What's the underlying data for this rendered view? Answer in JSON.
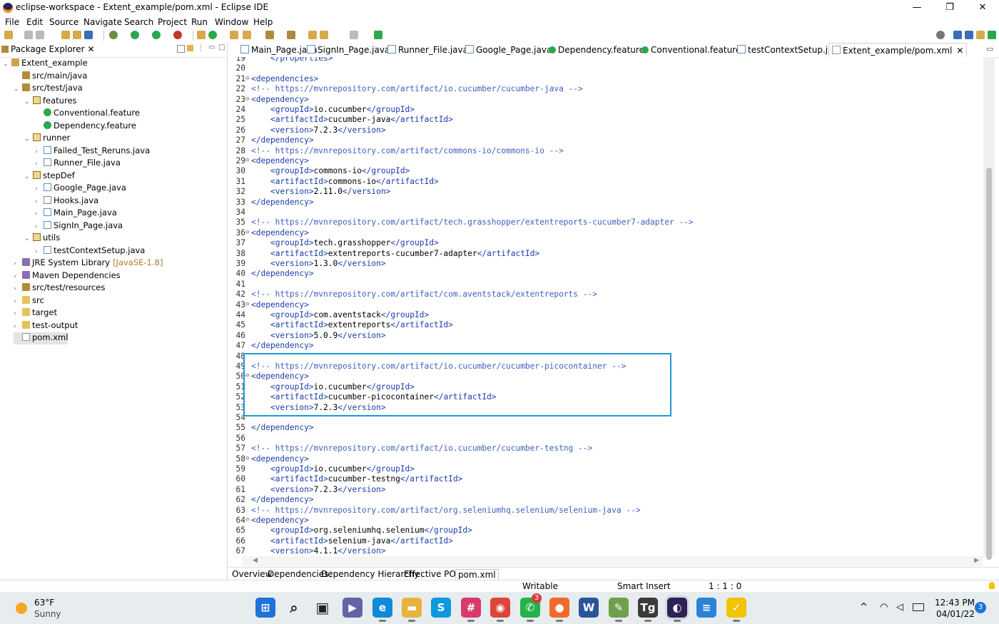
{
  "window": {
    "title": "eclipse-workspace - Extent_example/pom.xml - Eclipse IDE",
    "minimize": "—",
    "restore": "❐",
    "close": "✕"
  },
  "menu": [
    "File",
    "Edit",
    "Source",
    "Navigate",
    "Search",
    "Project",
    "Run",
    "Window",
    "Help"
  ],
  "package_explorer": {
    "title": "Package Explorer",
    "close": "✕",
    "tree": [
      {
        "label": "Extent_example",
        "twisty": "⌄",
        "icon": "project-icon"
      },
      {
        "label": "src/main/java",
        "twisty": "",
        "icon": "source-folder-icon"
      },
      {
        "label": "src/test/java",
        "twisty": "⌄",
        "icon": "source-folder-icon"
      },
      {
        "label": "features",
        "twisty": "⌄",
        "icon": "package-icon"
      },
      {
        "label": "Conventional.feature",
        "twisty": "",
        "icon": "feature-file-icon"
      },
      {
        "label": "Dependency.feature",
        "twisty": "",
        "icon": "feature-file-icon"
      },
      {
        "label": "runner",
        "twisty": "⌄",
        "icon": "package-icon"
      },
      {
        "label": "Failed_Test_Reruns.java",
        "twisty": "›",
        "icon": "java-file-icon"
      },
      {
        "label": "Runner_File.java",
        "twisty": "›",
        "icon": "java-file-icon"
      },
      {
        "label": "stepDef",
        "twisty": "⌄",
        "icon": "package-icon"
      },
      {
        "label": "Google_Page.java",
        "twisty": "›",
        "icon": "java-file-icon"
      },
      {
        "label": "Hooks.java",
        "twisty": "›",
        "icon": "java-file-icon"
      },
      {
        "label": "Main_Page.java",
        "twisty": "›",
        "icon": "java-file-icon"
      },
      {
        "label": "SignIn_Page.java",
        "twisty": "›",
        "icon": "java-file-icon"
      },
      {
        "label": "utils",
        "twisty": "⌄",
        "icon": "package-icon"
      },
      {
        "label": "testContextSetup.java",
        "twisty": "›",
        "icon": "java-file-icon"
      },
      {
        "label": "JRE System Library",
        "suffix": "[JavaSE-1.8]",
        "twisty": "›",
        "icon": "library-icon"
      },
      {
        "label": "Maven Dependencies",
        "twisty": "›",
        "icon": "library-icon"
      },
      {
        "label": "src/test/resources",
        "twisty": "›",
        "icon": "source-folder-icon"
      },
      {
        "label": "src",
        "twisty": "›",
        "icon": "folder-icon"
      },
      {
        "label": "target",
        "twisty": "›",
        "icon": "folder-icon"
      },
      {
        "label": "test-output",
        "twisty": "›",
        "icon": "folder-icon"
      },
      {
        "label": "pom.xml",
        "twisty": "",
        "icon": "xml-file-icon"
      }
    ]
  },
  "editor_tabs": [
    {
      "label": "Main_Page.java",
      "icon": "java-file-icon"
    },
    {
      "label": "SignIn_Page.java",
      "icon": "java-file-icon"
    },
    {
      "label": "Runner_File.java",
      "icon": "java-file-icon"
    },
    {
      "label": "Google_Page.java",
      "icon": "java-file-icon"
    },
    {
      "label": "Dependency.feature",
      "icon": "feature-file-icon"
    },
    {
      "label": "Conventional.feature",
      "icon": "feature-file-icon"
    },
    {
      "label": "testContextSetup.java",
      "icon": "java-file-icon"
    },
    {
      "label": "Extent_example/pom.xml",
      "icon": "xml-file-icon",
      "active": true,
      "close": "✕"
    }
  ],
  "code_lines": [
    {
      "n": "19",
      "t": "    </properties>"
    },
    {
      "n": "20",
      "t": ""
    },
    {
      "n": "21",
      "t": "<dependencies>",
      "fold": true
    },
    {
      "n": "22",
      "t": "<!-- https://mvnrepository.com/artifact/io.cucumber/cucumber-java -->"
    },
    {
      "n": "23",
      "t": "<dependency>",
      "fold": true
    },
    {
      "n": "24",
      "t": "    <groupId>io.cucumber</groupId>"
    },
    {
      "n": "25",
      "t": "    <artifactId>cucumber-java</artifactId>"
    },
    {
      "n": "26",
      "t": "    <version>7.2.3</version>"
    },
    {
      "n": "27",
      "t": "</dependency>"
    },
    {
      "n": "28",
      "t": "<!-- https://mvnrepository.com/artifact/commons-io/commons-io -->"
    },
    {
      "n": "29",
      "t": "<dependency>",
      "fold": true
    },
    {
      "n": "30",
      "t": "    <groupId>commons-io</groupId>"
    },
    {
      "n": "31",
      "t": "    <artifactId>commons-io</artifactId>"
    },
    {
      "n": "32",
      "t": "    <version>2.11.0</version>"
    },
    {
      "n": "33",
      "t": "</dependency>"
    },
    {
      "n": "34",
      "t": ""
    },
    {
      "n": "35",
      "t": "<!-- https://mvnrepository.com/artifact/tech.grasshopper/extentreports-cucumber7-adapter -->"
    },
    {
      "n": "36",
      "t": "<dependency>",
      "fold": true
    },
    {
      "n": "37",
      "t": "    <groupId>tech.grasshopper</groupId>"
    },
    {
      "n": "38",
      "t": "    <artifactId>extentreports-cucumber7-adapter</artifactId>"
    },
    {
      "n": "39",
      "t": "    <version>1.3.0</version>"
    },
    {
      "n": "40",
      "t": "</dependency>"
    },
    {
      "n": "41",
      "t": ""
    },
    {
      "n": "42",
      "t": "<!-- https://mvnrepository.com/artifact/com.aventstack/extentreports -->"
    },
    {
      "n": "43",
      "t": "<dependency>",
      "fold": true
    },
    {
      "n": "44",
      "t": "    <groupId>com.aventstack</groupId>"
    },
    {
      "n": "45",
      "t": "    <artifactId>extentreports</artifactId>"
    },
    {
      "n": "46",
      "t": "    <version>5.0.9</version>"
    },
    {
      "n": "47",
      "t": "</dependency>"
    },
    {
      "n": "48",
      "t": ""
    },
    {
      "n": "49",
      "t": "<!-- https://mvnrepository.com/artifact/io.cucumber/cucumber-picocontainer -->"
    },
    {
      "n": "50",
      "t": "<dependency>",
      "fold": true
    },
    {
      "n": "51",
      "t": "    <groupId>io.cucumber</groupId>"
    },
    {
      "n": "52",
      "t": "    <artifactId>cucumber-picocontainer</artifactId>"
    },
    {
      "n": "53",
      "t": "    <version>7.2.3</version>"
    },
    {
      "n": "54",
      "t": ""
    },
    {
      "n": "55",
      "t": "</dependency>"
    },
    {
      "n": "56",
      "t": ""
    },
    {
      "n": "57",
      "t": "<!-- https://mvnrepository.com/artifact/io.cucumber/cucumber-testng -->"
    },
    {
      "n": "58",
      "t": "<dependency>",
      "fold": true
    },
    {
      "n": "59",
      "t": "    <groupId>io.cucumber</groupId>"
    },
    {
      "n": "60",
      "t": "    <artifactId>cucumber-testng</artifactId>"
    },
    {
      "n": "61",
      "t": "    <version>7.2.3</version>"
    },
    {
      "n": "62",
      "t": "</dependency>"
    },
    {
      "n": "63",
      "t": "<!-- https://mvnrepository.com/artifact/org.seleniumhq.selenium/selenium-java -->"
    },
    {
      "n": "64",
      "t": "<dependency>",
      "fold": true
    },
    {
      "n": "65",
      "t": "    <groupId>org.seleniumhq.selenium</groupId>"
    },
    {
      "n": "66",
      "t": "    <artifactId>selenium-java</artifactId>"
    },
    {
      "n": "67",
      "t": "    <version>4.1.1</version>"
    }
  ],
  "bottom_tabs": [
    "Overview",
    "Dependencies",
    "Dependency Hierarchy",
    "Effective POM",
    "pom.xml"
  ],
  "bottom_active": "pom.xml",
  "status": {
    "writable": "Writable",
    "insert": "Smart Insert",
    "position": "1 : 1 : 0"
  },
  "taskbar": {
    "weather_temp": "63°F",
    "weather_desc": "Sunny",
    "time": "12:43 PM",
    "date": "04/01/22",
    "notifications": "3",
    "whatsapp_badge": "3",
    "chevron": "^",
    "apps": [
      {
        "name": "start-icon",
        "glyph": "⊞",
        "color": "#1e73d8"
      },
      {
        "name": "search-icon",
        "glyph": "⌕",
        "color": "#333333"
      },
      {
        "name": "task-view-icon",
        "glyph": "▣",
        "color": "#333333"
      },
      {
        "name": "teams-icon",
        "glyph": "▶",
        "color": "#6264a7"
      },
      {
        "name": "edge-icon",
        "glyph": "e",
        "color": "#0f8ad8"
      },
      {
        "name": "file-explorer-icon",
        "glyph": "▬",
        "color": "#e8b33a"
      },
      {
        "name": "skype-icon",
        "glyph": "S",
        "color": "#0b9ae0"
      },
      {
        "name": "slack-icon",
        "glyph": "#",
        "color": "#d93a6c"
      },
      {
        "name": "chrome-icon",
        "glyph": "◉",
        "color": "#dc4537"
      },
      {
        "name": "whatsapp-icon",
        "glyph": "✆",
        "color": "#25b24a"
      },
      {
        "name": "firefox-icon",
        "glyph": "●",
        "color": "#f06a2b"
      },
      {
        "name": "word-icon",
        "glyph": "W",
        "color": "#2a5699"
      },
      {
        "name": "notepad-plus-icon",
        "glyph": "✎",
        "color": "#6fa04b"
      },
      {
        "name": "tg-icon",
        "glyph": "Tg",
        "color": "#3b3b3b"
      },
      {
        "name": "eclipse-icon",
        "glyph": "◐",
        "color": "#2c2255"
      },
      {
        "name": "notepad-icon",
        "glyph": "≡",
        "color": "#2b83d8"
      },
      {
        "name": "norton-icon",
        "glyph": "✓",
        "color": "#f2c300"
      }
    ]
  }
}
